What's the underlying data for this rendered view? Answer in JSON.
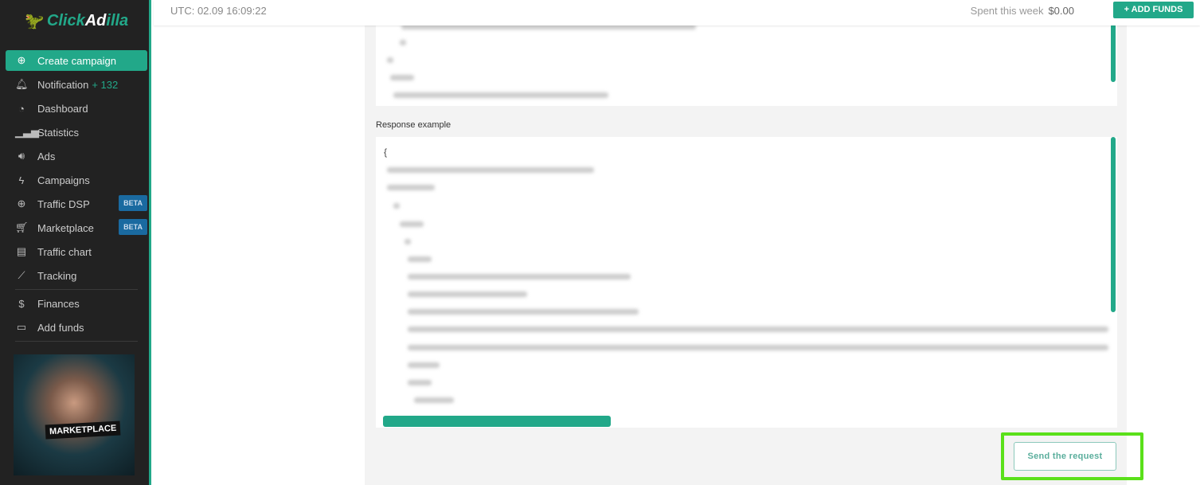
{
  "app": {
    "logo_prefix": "Click",
    "logo_mid": "Ad",
    "logo_suffix": "illa"
  },
  "sidebar": {
    "items": [
      {
        "label": "Create campaign",
        "icon": "plus-circle-icon"
      },
      {
        "label": "Notification",
        "count": "+ 132",
        "icon": "bell-icon"
      },
      {
        "label": "Dashboard",
        "icon": "pie-icon"
      },
      {
        "label": "Statistics",
        "icon": "bars-icon"
      },
      {
        "label": "Ads",
        "icon": "speaker-icon"
      },
      {
        "label": "Campaigns",
        "icon": "bolt-icon"
      },
      {
        "label": "Traffic DSP",
        "badge": "BETA",
        "icon": "globe-icon"
      },
      {
        "label": "Marketplace",
        "badge": "BETA",
        "icon": "cart-icon"
      },
      {
        "label": "Traffic chart",
        "icon": "document-icon"
      },
      {
        "label": "Tracking",
        "icon": "line-chart-icon"
      },
      {
        "label": "Finances",
        "icon": "dollar-icon"
      },
      {
        "label": "Add funds",
        "icon": "card-icon"
      }
    ],
    "promo_label": "MARKETPLACE"
  },
  "header": {
    "utc": "UTC: 02.09 16:09:22",
    "spent_label": "Spent this week",
    "spent_value": "$0.00",
    "add_funds": "+ ADD FUNDS"
  },
  "main": {
    "response_label": "Response example",
    "response_first_char": "{",
    "send_button": "Send the request"
  },
  "colors": {
    "accent": "#22a889",
    "highlight": "#5ae01a",
    "badge": "#1a6aa0"
  }
}
